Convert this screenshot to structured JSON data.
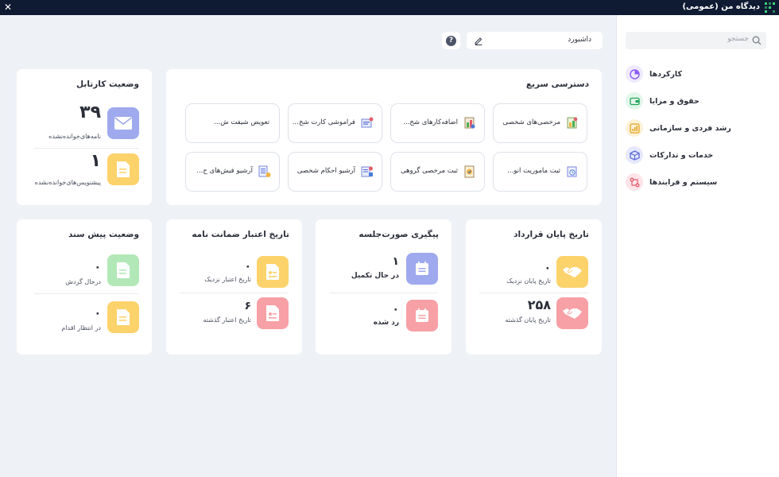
{
  "window": {
    "title": "دیدگاه من (عمومی)",
    "close": "✕"
  },
  "sidebar": {
    "search_placeholder": "جستجو",
    "items": [
      {
        "label": "کارکردها",
        "icon": "pie-chart-icon",
        "color": "#8b5cf6",
        "bg": "#efe9ff"
      },
      {
        "label": "حقوق و مزایا",
        "icon": "wallet-icon",
        "color": "#22a55a",
        "bg": "#e3f6ea"
      },
      {
        "label": "رشد فردی و سازمانی",
        "icon": "growth-chart-icon",
        "color": "#e3a21a",
        "bg": "#fdf1d8"
      },
      {
        "label": "خدمات و تدارکات",
        "icon": "box-icon",
        "color": "#5b6bd8",
        "bg": "#e6e9fb"
      },
      {
        "label": "سیستم و فرایندها",
        "icon": "workflow-icon",
        "color": "#e25c6e",
        "bg": "#fde4e8"
      }
    ]
  },
  "toolbar": {
    "dashboard_label": "داشبورد",
    "help": "?"
  },
  "quick_access": {
    "title": "دسترسی سریع",
    "buttons": [
      {
        "label": "مرخصی‌های شخصی",
        "icon": "leave-icon"
      },
      {
        "label": "اضافه‌کارهای شخ...",
        "icon": "overtime-icon"
      },
      {
        "label": "فراموشی کارت شخ...",
        "icon": "forgot-card-icon"
      },
      {
        "label": "تعویض شیفت ش...",
        "icon": ""
      },
      {
        "label": "ثبت ماموریت انو...",
        "icon": "mission-icon"
      },
      {
        "label": "ثبت مرخصی گروهی",
        "icon": "group-leave-icon"
      },
      {
        "label": "آرشیو احکام شخصی",
        "icon": "decrees-archive-icon"
      },
      {
        "label": "آرشیو فیش‌های ح...",
        "icon": "payslip-archive-icon"
      }
    ]
  },
  "kartabl": {
    "title": "وضعیت کارتابل",
    "unread_letters": {
      "value": "۳۹",
      "label": "نامه‌های‌خوانده‌نشده"
    },
    "unread_followups": {
      "value": "۱",
      "label": "پیشنویس‌های‌خوانده‌نشده"
    }
  },
  "contract_end": {
    "title": "تاریخ پایان قرارداد",
    "near": {
      "value": "۰",
      "label": "تاریخ پایان نزدیک"
    },
    "past": {
      "value": "۲۵۸",
      "label": "تاریخ پایان گذشته"
    }
  },
  "minutes": {
    "title": "پیگیری صورت‌جلسه",
    "in_progress": {
      "value": "۱",
      "label": "در حال تکمیل"
    },
    "rejected": {
      "value": "۰",
      "label": "رد شده"
    }
  },
  "guarantee": {
    "title": "تاریخ اعتبار ضمانت نامه",
    "near": {
      "value": "۰",
      "label": "تاریخ اعتبار نزدیک"
    },
    "past": {
      "value": "۶",
      "label": "تاریخ اعتبار گذشته"
    }
  },
  "draft_docs": {
    "title": "وضعیت پیش سند",
    "circulating": {
      "value": "۰",
      "label": "درحال گردش"
    },
    "pending": {
      "value": "۰",
      "label": "در انتظار اقدام"
    }
  },
  "colors": {
    "titlebar": "#0f1b33",
    "mail_blue": "#9fa9ee",
    "doc_yellow": "#fcd26b",
    "doc_green": "#b2e8b8",
    "calendar_blue": "#9fa9ee",
    "calendar_red": "#f7a0a6",
    "handshake_yellow": "#fcd26b",
    "handshake_red": "#f7a0a6"
  }
}
